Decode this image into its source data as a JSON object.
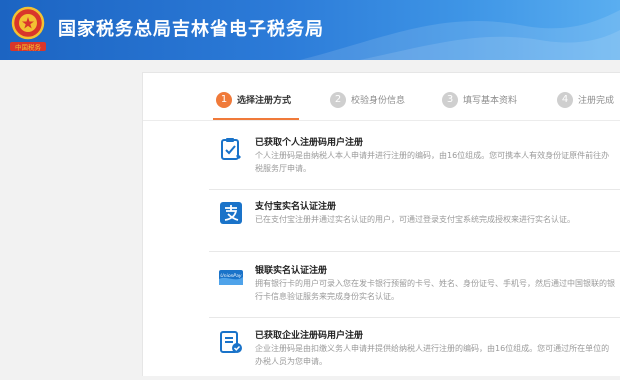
{
  "header": {
    "emblem_text": "中国税务",
    "title": "国家税务总局吉林省电子税务局"
  },
  "steps": [
    {
      "num": "1",
      "label": "选择注册方式"
    },
    {
      "num": "2",
      "label": "校验身份信息"
    },
    {
      "num": "3",
      "label": "填写基本资料"
    },
    {
      "num": "4",
      "label": "注册完成"
    }
  ],
  "options": [
    {
      "icon": "document-check-icon",
      "title": "已获取个人注册码用户注册",
      "desc": "个人注册码是由纳税人本人申请并进行注册的编码，由16位组成。您可携本人有效身份证原件前往办税服务厅申请。"
    },
    {
      "icon": "alipay-icon",
      "title": "支付宝实名认证注册",
      "desc": "已在支付宝注册并通过实名认证的用户，可通过登录支付宝系统完成授权来进行实名认证。"
    },
    {
      "icon": "unionpay-card-icon",
      "title": "银联实名认证注册",
      "desc": "拥有银行卡的用户可录入您在发卡银行预留的卡号、姓名、身份证号、手机号，然后通过中国银联的银行卡信息验证服务来完成身份实名认证。",
      "card_text": "UnionPay"
    },
    {
      "icon": "enterprise-registration-icon",
      "title": "已获取企业注册码用户注册",
      "desc": "企业注册码是由扣缴义务人申请并提供给纳税人进行注册的编码，由16位组成。您可通过所在单位的办税人员为您申请。"
    }
  ],
  "colors": {
    "header_blue": "#2a74d0",
    "active_step": "#f07a3a",
    "icon_blue": "#1a73c9"
  }
}
